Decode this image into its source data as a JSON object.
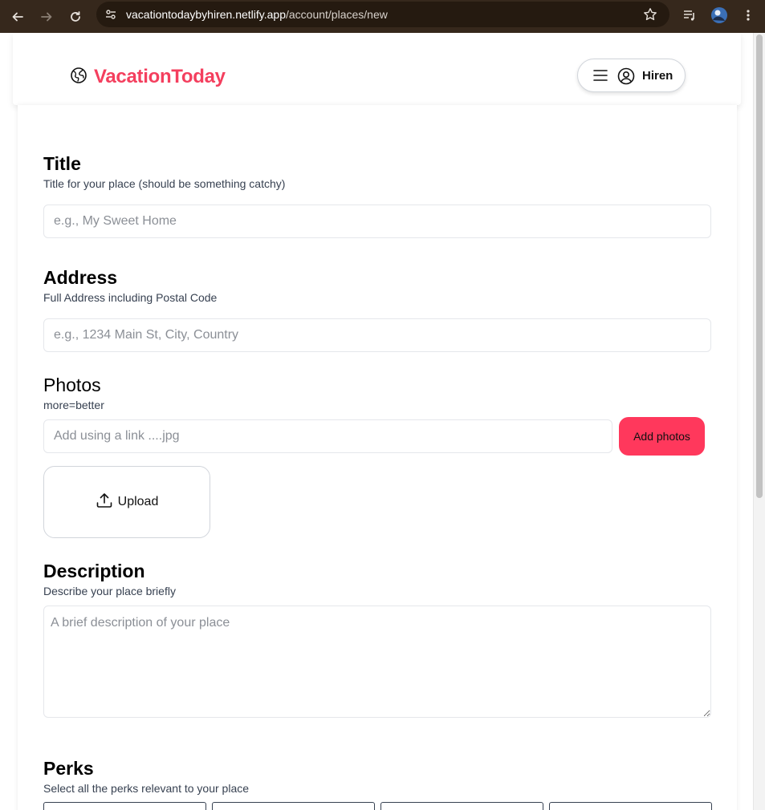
{
  "browser": {
    "url_host": "vacationtodaybyhiren.netlify.app",
    "url_path": "/account/places/new"
  },
  "header": {
    "brand": "VacationToday",
    "user_name": "Hiren"
  },
  "form": {
    "title": {
      "heading": "Title",
      "help": "Title for your place (should be something catchy)",
      "placeholder": "e.g., My Sweet Home"
    },
    "address": {
      "heading": "Address",
      "help": "Full Address including Postal Code",
      "placeholder": "e.g., 1234 Main St, City, Country"
    },
    "photos": {
      "heading": "Photos",
      "help": "more=better",
      "placeholder": "Add using a link ....jpg",
      "add_label": "Add photos",
      "upload_label": "Upload"
    },
    "description": {
      "heading": "Description",
      "help": "Describe your place briefly",
      "placeholder": "A brief description of your place"
    },
    "perks": {
      "heading": "Perks",
      "help": "Select all the perks relevant to your place"
    }
  },
  "colors": {
    "brand": "#f43f5e",
    "accent_button": "#ff385c",
    "chrome_bg": "#36281c"
  }
}
